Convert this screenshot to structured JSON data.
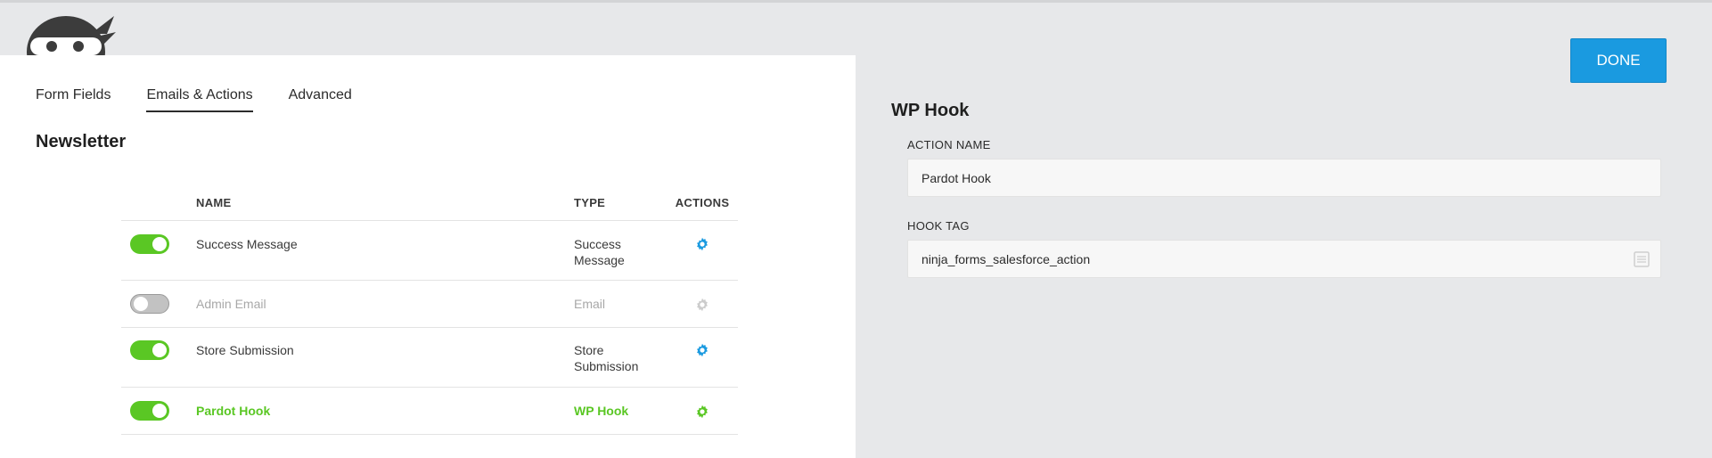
{
  "tabs": [
    {
      "label": "Form Fields"
    },
    {
      "label": "Emails & Actions"
    },
    {
      "label": "Advanced"
    }
  ],
  "form_title": "Newsletter",
  "table": {
    "headers": {
      "name": "NAME",
      "type": "TYPE",
      "actions": "ACTIONS"
    },
    "rows": [
      {
        "name": "Success Message",
        "type_line1": "Success",
        "type_line2": "Message",
        "enabled": true
      },
      {
        "name": "Admin Email",
        "type_line1": "Email",
        "type_line2": "",
        "enabled": false
      },
      {
        "name": "Store Submission",
        "type_line1": "Store",
        "type_line2": "Submission",
        "enabled": true
      },
      {
        "name": "Pardot Hook",
        "type_line1": "WP Hook",
        "type_line2": "",
        "enabled": true,
        "selected": true
      }
    ]
  },
  "done_label": "DONE",
  "settings": {
    "title": "WP Hook",
    "action_name_label": "ACTION NAME",
    "action_name_value": "Pardot Hook",
    "hook_tag_label": "HOOK TAG",
    "hook_tag_value": "ninja_forms_salesforce_action"
  },
  "colors": {
    "accent_blue": "#1a9ae0",
    "toggle_on": "#5ac724",
    "toggle_off": "#c2c2c2",
    "gear_active": "#1a9ae0",
    "gear_selected": "#5ac724",
    "gear_disabled": "#cccccc"
  },
  "icons": {
    "logo": "ninja-logo-icon",
    "gear": "gear-icon",
    "merge_tags": "merge-tags-icon"
  }
}
